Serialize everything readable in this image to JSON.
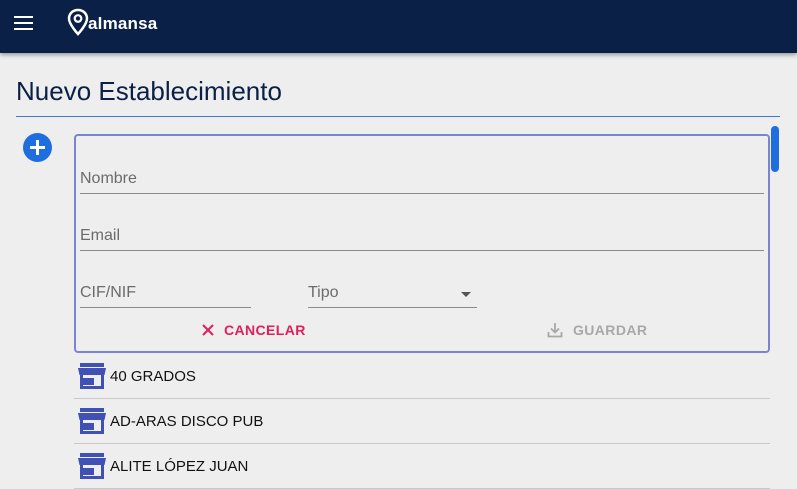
{
  "app": {
    "name": "almansa"
  },
  "header": {
    "menu_icon": "hamburger-menu-icon",
    "logo_icon": "location-pin-icon"
  },
  "page": {
    "title": "Nuevo Establecimiento"
  },
  "form": {
    "fields": {
      "nombre": {
        "placeholder": "Nombre",
        "value": ""
      },
      "email": {
        "placeholder": "Email",
        "value": ""
      },
      "cif": {
        "placeholder": "CIF/NIF",
        "value": ""
      },
      "tipo": {
        "placeholder": "Tipo",
        "value": ""
      }
    },
    "cancel_label": "CANCELAR",
    "save_label": "GUARDAR"
  },
  "establishments": [
    {
      "name": "40 GRADOS"
    },
    {
      "name": "AD-ARAS DISCO PUB"
    },
    {
      "name": "ALITE LÓPEZ JUAN"
    }
  ],
  "colors": {
    "header_bg": "#0b2046",
    "accent": "#1f6ee0",
    "cancel": "#e01f5a",
    "disabled": "#a8a8a8",
    "store_icon": "#3f51b5"
  }
}
